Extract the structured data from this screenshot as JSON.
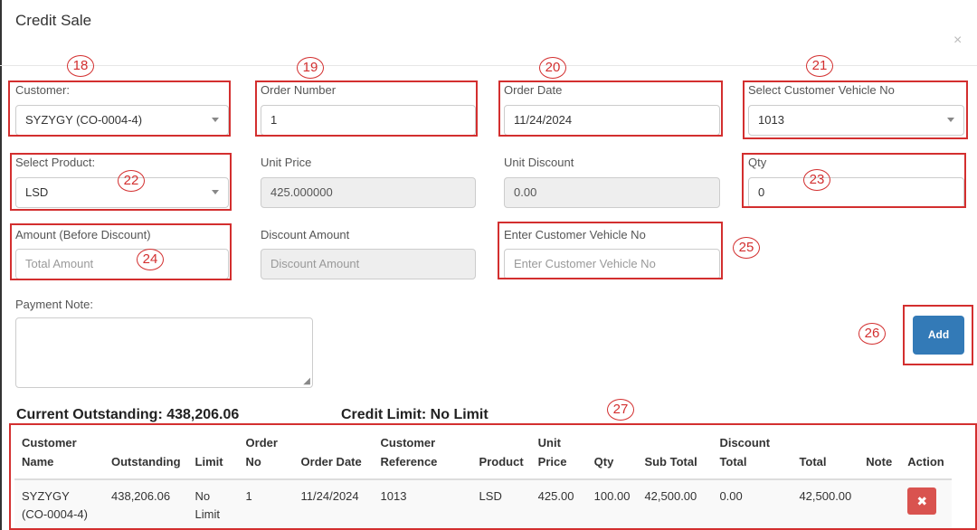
{
  "modal": {
    "title": "Credit Sale",
    "close_icon": "close-icon"
  },
  "fields": {
    "customer": {
      "label": "Customer:",
      "value": "SYZYGY (CO-0004-4)"
    },
    "order_number": {
      "label": "Order Number",
      "value": "1"
    },
    "order_date": {
      "label": "Order Date",
      "value": "11/24/2024"
    },
    "vehicle_select": {
      "label": "Select Customer Vehicle No",
      "value": "1013"
    },
    "product": {
      "label": "Select Product:",
      "value": "LSD"
    },
    "unit_price": {
      "label": "Unit Price",
      "value": "425.000000"
    },
    "unit_discount": {
      "label": "Unit Discount",
      "value": "0.00"
    },
    "qty": {
      "label": "Qty",
      "value": "0"
    },
    "amount": {
      "label": "Amount (Before Discount)",
      "placeholder": "Total Amount"
    },
    "discount_amount": {
      "label": "Discount Amount",
      "placeholder": "Discount Amount"
    },
    "vehicle_input": {
      "label": "Enter Customer Vehicle No",
      "placeholder": "Enter Customer Vehicle No"
    },
    "payment_note": {
      "label": "Payment Note:"
    }
  },
  "add_button": "Add",
  "summary": {
    "outstanding": "Current Outstanding: 438,206.06",
    "credit_limit": "Credit Limit: No Limit"
  },
  "annotations": {
    "a18": "18",
    "a19": "19",
    "a20": "20",
    "a21": "21",
    "a22": "22",
    "a23": "23",
    "a24": "24",
    "a25": "25",
    "a26": "26",
    "a27": "27"
  },
  "annotation_color": "#d32f2f",
  "table": {
    "headers": [
      "Customer Name",
      "Outstanding",
      "Limit",
      "Order No",
      "Order Date",
      "Customer Reference",
      "Product",
      "Unit Price",
      "Qty",
      "Sub Total",
      "Discount Total",
      "Total",
      "Note",
      "Action"
    ],
    "rows": [
      [
        "SYZYGY (CO-0004-4)",
        "438,206.06",
        "No Limit",
        "1",
        "11/24/2024",
        "1013",
        "LSD",
        "425.00",
        "100.00",
        "42,500.00",
        "0.00",
        "42,500.00",
        "",
        "delete-icon"
      ]
    ]
  },
  "colors": {
    "primary": "#337ab7",
    "danger": "#d9534f"
  }
}
